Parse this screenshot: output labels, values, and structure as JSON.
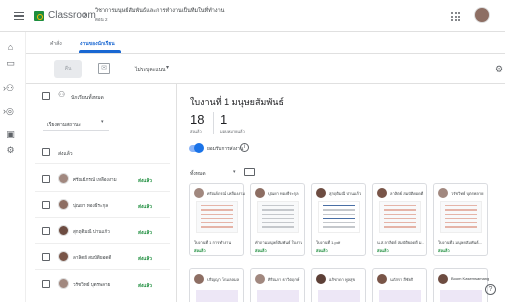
{
  "header": {
    "app_name": "Classroom",
    "breadcrumb_sep": "›",
    "class_name": "วิชาการมนุษย์สัมพันธ์และการทำงานเป็นทีมในที่ทำงาน",
    "class_section": "ตอน 2"
  },
  "tabs": [
    {
      "label": "คำสั่ง"
    },
    {
      "label": "งานของนักเรียน"
    }
  ],
  "toolbar": {
    "return_label": "คืน",
    "points_label": "ไม่ระบุคะแนน",
    "points_arrow": "▾"
  },
  "left": {
    "all_students": "นักเรียนทั้งหมด",
    "sort_label": "เรียงตามสถานะ",
    "sort_arrow": "▾",
    "group_label": "ส่งแล้ว",
    "students": [
      {
        "name": "ศรัณย์ภรณ์ เหลืองงาม",
        "status": "ส่งแล้ว",
        "color": "#a1887f"
      },
      {
        "name": "ปุณยา ทองธีระกุล",
        "status": "ส่งแล้ว",
        "color": "#8d6e63"
      },
      {
        "name": "สุกฤติมณี ปานแก้ว",
        "status": "ส่งแล้ว",
        "color": "#6d4c41"
      },
      {
        "name": "ลาลิตย์ สมบัติยอดดี",
        "status": "ส่งแล้ว",
        "color": "#795548"
      },
      {
        "name": "วรัชวิทย์ บุตรพลาย",
        "status": "ส่งแล้ว",
        "color": "#a1887f"
      }
    ]
  },
  "assignment": {
    "title": "ใบงานที่ 1 มนุษยสัมพันธ์",
    "submitted_count": "18",
    "submitted_label": "ส่งแล้ว",
    "assigned_count": "1",
    "assigned_label": "มอบหมายแล้ว",
    "accepting_label": "ยอมรับการส่งงาน",
    "filter_label": "ทั้งหมด",
    "filter_arrow": "▾"
  },
  "cards": [
    {
      "name": "ศรัณย์ภรณ์ เหลืองงาม",
      "file": "ใบงานที่ 1 การทำงาน",
      "status": "ส่งแล้ว",
      "color": "#a1887f",
      "thumb": "reddish"
    },
    {
      "name": "ปุณยา ทองธีระกุล",
      "file": "คำถามมนุษย์สัมพันธ์ ใบงานที่...",
      "status": "ส่งแล้ว",
      "color": "#8d6e63",
      "thumb": "plain"
    },
    {
      "name": "สุกฤติมณี ปานแก้ว",
      "file": "ใบงานที่ 1.pdf",
      "status": "ส่งแล้ว",
      "color": "#6d4c41",
      "thumb": "doc"
    },
    {
      "name": "ลาลิตย์ สมบัติยอดดี",
      "file": "น.ส.ลาลิตย์ สมบัติยอดดี ม...",
      "status": "ส่งแล้ว",
      "color": "#795548",
      "thumb": "reddish"
    },
    {
      "name": "วรัชวิทย์ บุตรพลาย",
      "file": "ใบงานที่1 มนุษยสัมพันธ์...",
      "status": "ส่งแล้ว",
      "color": "#a1887f",
      "thumb": "reddish"
    }
  ],
  "cards_row2": [
    {
      "name": "ปริญญา โกมลลมล",
      "color": "#8d6e63"
    },
    {
      "name": "ศิริณภา ธาวิตฤกษ์",
      "color": "#a1887f"
    },
    {
      "name": "อภิชาดา พูลสุข",
      "color": "#5d4037"
    },
    {
      "name": "นภัสรา สีชัยกิ",
      "color": "#795548"
    },
    {
      "name": "Boom Kasemsamang",
      "color": "#6d4c41"
    }
  ]
}
